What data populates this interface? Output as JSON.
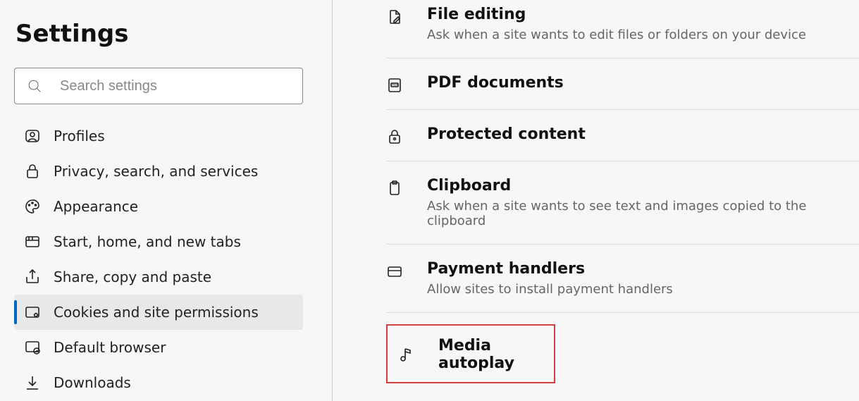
{
  "sidebar": {
    "title": "Settings",
    "search_placeholder": "Search settings",
    "items": [
      {
        "label": "Profiles"
      },
      {
        "label": "Privacy, search, and services"
      },
      {
        "label": "Appearance"
      },
      {
        "label": "Start, home, and new tabs"
      },
      {
        "label": "Share, copy and paste"
      },
      {
        "label": "Cookies and site permissions"
      },
      {
        "label": "Default browser"
      },
      {
        "label": "Downloads"
      }
    ]
  },
  "main": {
    "rows": [
      {
        "title": "File editing",
        "sub": "Ask when a site wants to edit files or folders on your device"
      },
      {
        "title": "PDF documents",
        "sub": ""
      },
      {
        "title": "Protected content",
        "sub": ""
      },
      {
        "title": "Clipboard",
        "sub": "Ask when a site wants to see text and images copied to the clipboard"
      },
      {
        "title": "Payment handlers",
        "sub": "Allow sites to install payment handlers"
      },
      {
        "title": "Media autoplay",
        "sub": ""
      }
    ]
  }
}
